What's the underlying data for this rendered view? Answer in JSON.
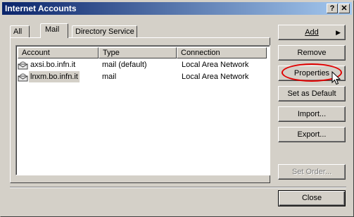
{
  "window": {
    "title": "Internet Accounts",
    "help_glyph": "?",
    "close_glyph": "✕"
  },
  "tabs": [
    {
      "label": "All"
    },
    {
      "label": "Mail",
      "active": true
    },
    {
      "label": "Directory Service"
    }
  ],
  "list": {
    "columns": [
      "Account",
      "Type",
      "Connection"
    ],
    "rows": [
      {
        "account": "axsi.bo.infn.it",
        "type": "mail (default)",
        "connection": "Local Area Network"
      },
      {
        "account": "lnxm.bo.infn.it",
        "type": "mail",
        "connection": "Local Area Network",
        "selected": true
      }
    ]
  },
  "buttons": {
    "add": "Add",
    "add_arrow": "▶",
    "remove": "Remove",
    "properties": "Properties",
    "set_default": "Set as Default",
    "import": "Import...",
    "export": "Export...",
    "set_order": "Set Order...",
    "close": "Close"
  },
  "icons": {
    "account": "mail-account-icon",
    "cursor": "mouse-pointer-icon"
  },
  "colors": {
    "titlebar_start": "#0a246a",
    "titlebar_end": "#a6caf0",
    "highlight_ring": "#e00000",
    "face": "#d4d0c8"
  }
}
